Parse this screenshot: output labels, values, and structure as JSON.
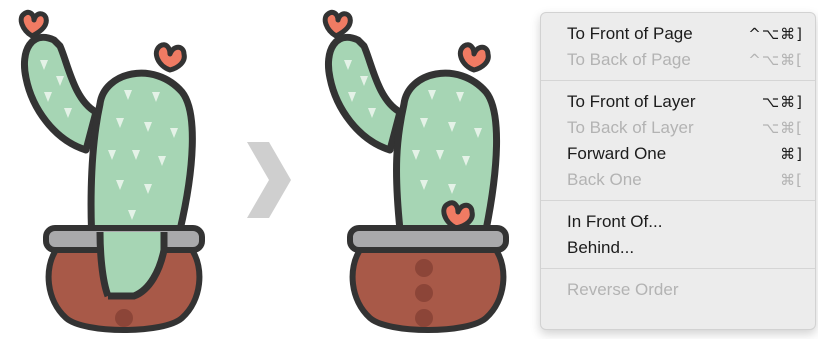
{
  "illustrations": {
    "before_label": "",
    "after_label": ""
  },
  "menu": {
    "groups": [
      [
        {
          "label": "To Front of Page",
          "shortcut": "^⌥⌘]",
          "enabled": true
        },
        {
          "label": "To Back of Page",
          "shortcut": "^⌥⌘[",
          "enabled": false
        }
      ],
      [
        {
          "label": "To Front of Layer",
          "shortcut": "⌥⌘]",
          "enabled": true
        },
        {
          "label": "To Back of Layer",
          "shortcut": "⌥⌘[",
          "enabled": false
        },
        {
          "label": "Forward One",
          "shortcut": "⌘]",
          "enabled": true
        },
        {
          "label": "Back One",
          "shortcut": "⌘[",
          "enabled": false
        }
      ],
      [
        {
          "label": "In Front Of...",
          "shortcut": "",
          "enabled": true
        },
        {
          "label": "Behind...",
          "shortcut": "",
          "enabled": true
        }
      ],
      [
        {
          "label": "Reverse Order",
          "shortcut": "",
          "enabled": false
        }
      ]
    ]
  },
  "colors": {
    "cactus": "#a6d5b4",
    "outline": "#333333",
    "flower": "#f07b63",
    "pot": "#a85948",
    "pot_rim": "#a9a9ab",
    "arrow": "#cfcfcf"
  },
  "icons": [
    "cactus-before-illustration",
    "chevron-right-icon",
    "cactus-after-illustration"
  ]
}
